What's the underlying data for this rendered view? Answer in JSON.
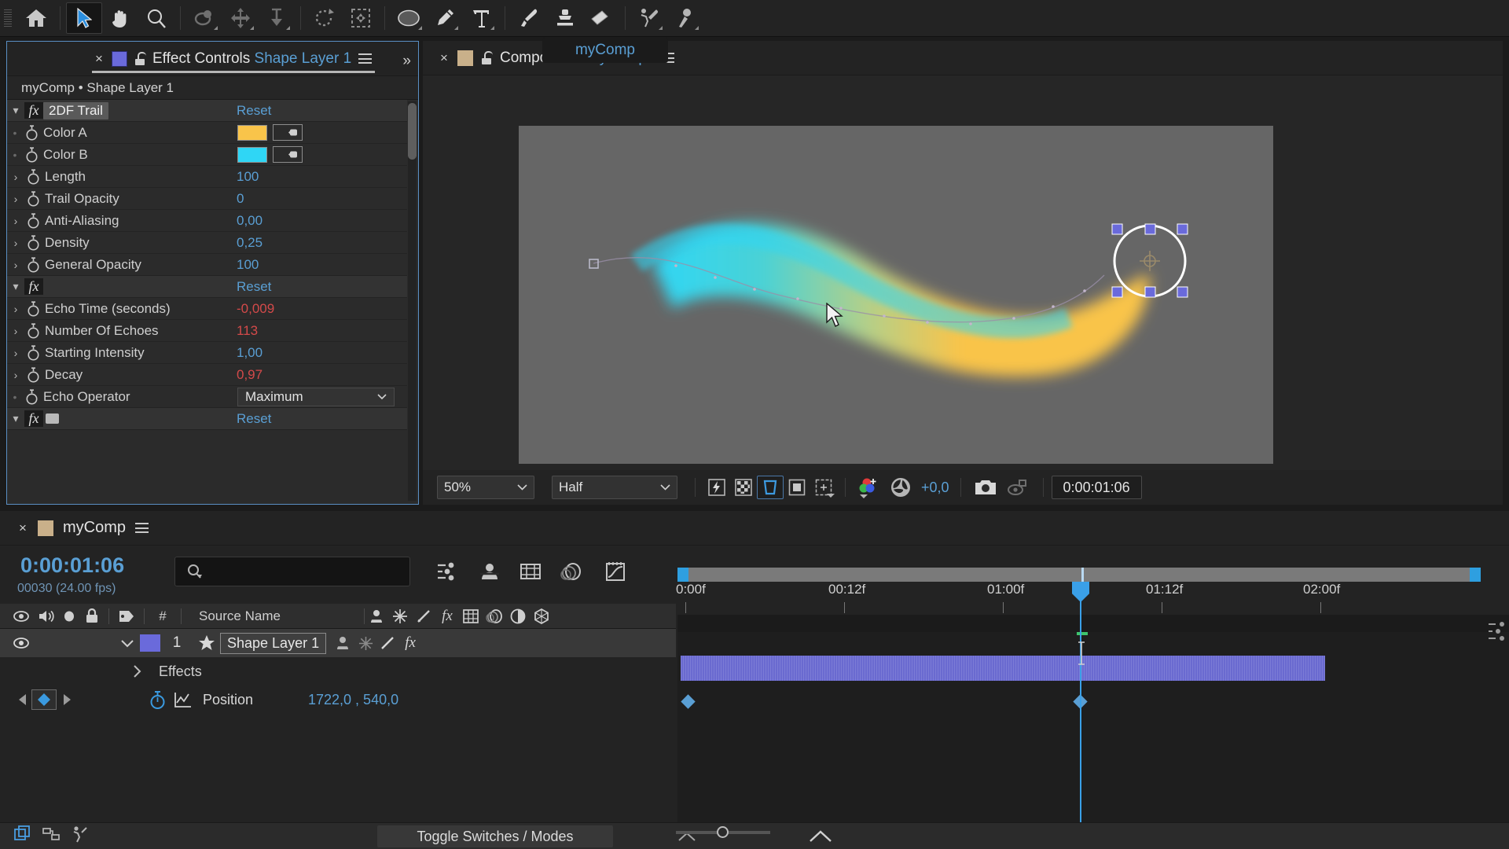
{
  "toolbar": {
    "tools": [
      {
        "name": "home-icon",
        "label": "Home"
      },
      {
        "name": "selection-tool",
        "label": "Selection Tool"
      },
      {
        "name": "hand-tool",
        "label": "Hand Tool"
      },
      {
        "name": "zoom-tool",
        "label": "Zoom Tool"
      },
      {
        "name": "orbit-tool",
        "label": "Orbit Around Cursor Tool"
      },
      {
        "name": "pan-tool",
        "label": "Pan Under Cursor Tool"
      },
      {
        "name": "dolly-tool",
        "label": "Dolly Towards Cursor Tool"
      },
      {
        "name": "rotation-tool",
        "label": "Rotation Tool"
      },
      {
        "name": "anchor-point-tool",
        "label": "Pan Behind Tool"
      },
      {
        "name": "shape-tool",
        "label": "Rectangle Tool"
      },
      {
        "name": "pen-tool",
        "label": "Pen Tool"
      },
      {
        "name": "type-tool",
        "label": "Type Tool"
      },
      {
        "name": "brush-tool",
        "label": "Brush Tool"
      },
      {
        "name": "clone-stamp-tool",
        "label": "Clone Stamp Tool"
      },
      {
        "name": "eraser-tool",
        "label": "Eraser Tool"
      },
      {
        "name": "roto-brush-tool",
        "label": "Roto Brush Tool"
      },
      {
        "name": "puppet-pin-tool",
        "label": "Puppet Pin Tool"
      }
    ]
  },
  "effect_controls": {
    "tab_title": "Effect Controls",
    "tab_subject": "Shape Layer 1",
    "breadcrumb": "myComp • Shape Layer 1",
    "groups": [
      {
        "effect_name": "2DF Trail",
        "reset_label": "Reset",
        "params": [
          {
            "label": "Color A",
            "type": "color",
            "value": "#F9C44A",
            "twirl": false
          },
          {
            "label": "Color B",
            "type": "color",
            "value": "#2FD6F5",
            "twirl": false
          },
          {
            "label": "Length",
            "type": "number",
            "value": "100",
            "color": "blue",
            "twirl": true
          },
          {
            "label": "Trail Opacity",
            "type": "number",
            "value": "0",
            "color": "blue",
            "twirl": true
          },
          {
            "label": "Anti-Aliasing",
            "type": "number",
            "value": "0,00",
            "color": "blue",
            "twirl": true
          },
          {
            "label": "Density",
            "type": "number",
            "value": "0,25",
            "color": "blue",
            "twirl": true
          },
          {
            "label": "General Opacity",
            "type": "number",
            "value": "100",
            "color": "blue",
            "twirl": true
          }
        ]
      },
      {
        "effect_name": "",
        "reset_label": "Reset",
        "params": [
          {
            "label": "Echo Time (seconds)",
            "type": "number",
            "value": "-0,009",
            "color": "red",
            "twirl": true
          },
          {
            "label": "Number Of Echoes",
            "type": "number",
            "value": "113",
            "color": "red",
            "twirl": true
          },
          {
            "label": "Starting Intensity",
            "type": "number",
            "value": "1,00",
            "color": "blue",
            "twirl": true
          },
          {
            "label": "Decay",
            "type": "number",
            "value": "0,97",
            "color": "red",
            "twirl": true
          },
          {
            "label": "Echo Operator",
            "type": "select",
            "value": "Maximum",
            "twirl": false
          }
        ]
      },
      {
        "effect_name": "",
        "reset_label": "Reset",
        "params": []
      }
    ]
  },
  "composition": {
    "tab_title": "Composition",
    "tab_subject": "myComp",
    "sub_tab": "myComp",
    "viewer": {
      "zoom_level": "50%",
      "resolution": "Half",
      "exposure": "+0,0",
      "timecode": "0:00:01:06",
      "toggles": [
        {
          "name": "fast-previews-icon"
        },
        {
          "name": "transparency-grid-icon"
        },
        {
          "name": "region-of-interest-icon"
        },
        {
          "name": "mask-shape-icon"
        },
        {
          "name": "title-action-safe-icon"
        },
        {
          "name": "channel-rgb-icon"
        },
        {
          "name": "exposure-aperture-icon"
        },
        {
          "name": "snapshot-icon"
        },
        {
          "name": "show-snapshot-icon"
        }
      ]
    }
  },
  "timeline": {
    "tab_title": "myComp",
    "current_timecode": "0:00:01:06",
    "frame_info": "00030 (24.00 fps)",
    "search_placeholder": "",
    "columns": {
      "source_name": "Source Name",
      "index": "#"
    },
    "layers": [
      {
        "index": "1",
        "name": "Shape Layer 1",
        "color": "#6a6adb",
        "properties": [
          {
            "label": "Effects",
            "value": "",
            "twirl": true
          },
          {
            "label": "Position",
            "value": "1722,0 , 540,0",
            "twirl": false,
            "has_keyframe": true
          }
        ]
      }
    ],
    "ruler_ticks": [
      "0:00f",
      "00:12f",
      "01:00f",
      "01:12f",
      "02:00f"
    ]
  },
  "statusbar": {
    "toggle_label": "Toggle Switches / Modes"
  },
  "colors": {
    "accent_blue": "#5a9fd4",
    "expression_red": "#d44a4a",
    "layer_purple": "#6a6adb",
    "color_a": "#F9C44A",
    "color_b": "#2FD6F5"
  }
}
